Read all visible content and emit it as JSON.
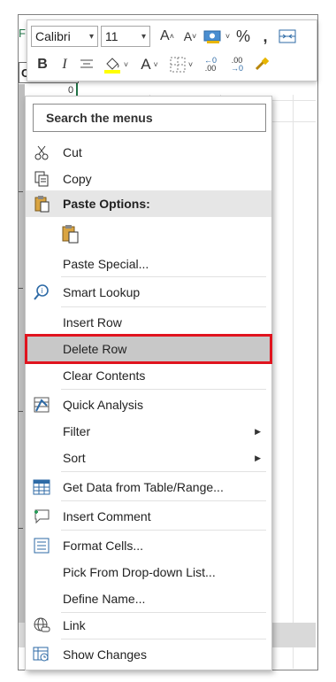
{
  "sheet": {
    "col_header_text": "Colu",
    "edge_letter": "F",
    "row_fragment": "0"
  },
  "mini_toolbar": {
    "font_name": "Calibri",
    "font_size": "11",
    "grow_font": "A",
    "shrink_font": "A",
    "percent": "%",
    "comma": ",",
    "bold": "B",
    "italic": "I",
    "font_color": "A",
    "inc_decimal": ".00",
    "dec_decimal": ".00"
  },
  "menu": {
    "search_label": "Search the menus",
    "items": [
      {
        "label": "Cut",
        "icon": "scissors-icon"
      },
      {
        "label": "Copy",
        "icon": "copy-icon"
      },
      {
        "label": "Paste Options:",
        "icon": "clipboard-icon"
      },
      {
        "label": "",
        "icon": "paste-icon"
      },
      {
        "label": "Paste Special...",
        "icon": ""
      },
      {
        "label": "Smart Lookup",
        "icon": "smart-lookup-icon"
      },
      {
        "label": "Insert Row",
        "icon": ""
      },
      {
        "label": "Delete Row",
        "icon": ""
      },
      {
        "label": "Clear Contents",
        "icon": ""
      },
      {
        "label": "Quick Analysis",
        "icon": "quick-analysis-icon"
      },
      {
        "label": "Filter",
        "icon": ""
      },
      {
        "label": "Sort",
        "icon": ""
      },
      {
        "label": "Get Data from Table/Range...",
        "icon": "table-range-icon"
      },
      {
        "label": "Insert Comment",
        "icon": "insert-comment-icon"
      },
      {
        "label": "Format Cells...",
        "icon": "format-cells-icon"
      },
      {
        "label": "Pick From Drop-down List...",
        "icon": ""
      },
      {
        "label": "Define Name...",
        "icon": ""
      },
      {
        "label": "Link",
        "icon": "link-icon"
      },
      {
        "label": "Show Changes",
        "icon": "show-changes-icon"
      }
    ]
  },
  "colors": {
    "highlight_border": "#e0141e",
    "highlight_fill": "#c8c8c8",
    "excel_green": "#217346"
  }
}
